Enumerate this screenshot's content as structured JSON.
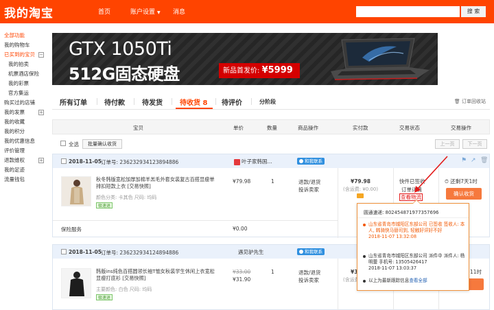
{
  "header": {
    "brand": "我的淘宝",
    "nav": {
      "home": "首页",
      "settings": "账户设置",
      "messages": "消息"
    },
    "search_placeholder": "",
    "search_button": "搜 索"
  },
  "sidebar": {
    "items": [
      {
        "label": "全部功能",
        "level": 1,
        "style": "head"
      },
      {
        "label": "我的购物车",
        "level": 1
      },
      {
        "label": "已买到的宝贝",
        "level": 1,
        "style": "active",
        "toggle": "−"
      },
      {
        "label": "我的拍卖",
        "level": 2
      },
      {
        "label": "机票酒店保险",
        "level": 2
      },
      {
        "label": "我的彩票",
        "level": 2
      },
      {
        "label": "官方集运",
        "level": 2
      },
      {
        "label": "购买过的店铺",
        "level": 1
      },
      {
        "label": "我的发票",
        "level": 1,
        "toggle": "+"
      },
      {
        "label": "我的收藏",
        "level": 1
      },
      {
        "label": "我的积分",
        "level": 1
      },
      {
        "label": "我的优惠信息",
        "level": 1
      },
      {
        "label": "评价管理",
        "level": 1
      },
      {
        "label": "退款维权",
        "level": 1,
        "toggle": "+"
      },
      {
        "label": "我的足迹",
        "level": 1
      },
      {
        "label": "流量钱包",
        "level": 1
      }
    ]
  },
  "banner": {
    "line1": "GTX 1050Ti",
    "line2": "512G固态硬盘",
    "price_label": "新品首发价:",
    "price_value": "¥5999"
  },
  "tabs": {
    "all": "所有订单",
    "to_pay": "待付款",
    "to_ship": "待发货",
    "to_receive": "待收货 8",
    "to_review": "待评价",
    "installment": "分阶段",
    "recycle": "订单回收站"
  },
  "table_header": {
    "item": "宝贝",
    "price": "单价",
    "qty": "数量",
    "ops": "商品操作",
    "paid": "实付款",
    "status": "交易状态",
    "actions": "交易操作"
  },
  "batch": {
    "select_all": "全选",
    "confirm": "批量确认收货",
    "prev": "上一页",
    "next": "下一页"
  },
  "orders": [
    {
      "date": "2018-11-05",
      "order_no_label": "订单号: 236232934123894886",
      "shop": "叶子家韩国...",
      "wangwang": "和我联系",
      "title": "秋冬韩版宽松加厚加棉羊羔毛外套女装复古百搭显瘦单排扣短款上衣 [交易快照]",
      "props": "颜色分类: 卡其色  尺码: 均码",
      "badge": "极速退",
      "price": "¥79.98",
      "qty": "1",
      "op1": "退款/退货",
      "op2": "投诉卖家",
      "paid": "¥79.98",
      "shipping": "(含运费: ¥0.00)",
      "status1": "快件已签收",
      "status2": "订单详情",
      "logistics": "查看物流",
      "remain": "还剩7天1时",
      "confirm": "确认收货",
      "service_label": "保险服务",
      "service_price": "¥0.00"
    },
    {
      "date": "2018-11-05",
      "order_no_label": "订单号: 236232934124894886",
      "shop": "遇见驴先生",
      "wangwang": "和我联系",
      "title": "韩版ins纯色百搭圆领长袖T恤女秋装学生休闲上衣宽松显瘦打底衫 [交易快照]",
      "props": "主要颜色: 白色  尺码: 均码",
      "badge": "极速退",
      "price_old": "¥33.00",
      "price": "¥31.90",
      "qty": "1",
      "op1": "退款/退货",
      "op2": "投诉卖家",
      "paid": "¥31.90",
      "shipping": "(含运费: ¥0.00)",
      "remain": "11时"
    }
  ],
  "popup": {
    "tracking": "圆通速递: 802454871977357696",
    "events": [
      {
        "text": "山东省青岛市城阳区东部公司 已签收 签收人: 本人, 韩骑快马替司到, 轻触好评好不好",
        "time": "2018-11-07 13:32:08",
        "tone": "hot"
      },
      {
        "text": "山东省青岛市城阳区东部公司 派件中 派件人: 杨明蕾 手机号: 13505426417",
        "time": "2018-11-07 13:03:37",
        "tone": "norm"
      },
      {
        "text": "以上为最新跟踪信息",
        "link": "查看全部",
        "tone": "norm"
      }
    ]
  },
  "colors": {
    "brand_orange": "#ff4400",
    "accent_red": "#e31a1a",
    "link_blue": "#2462b3"
  }
}
